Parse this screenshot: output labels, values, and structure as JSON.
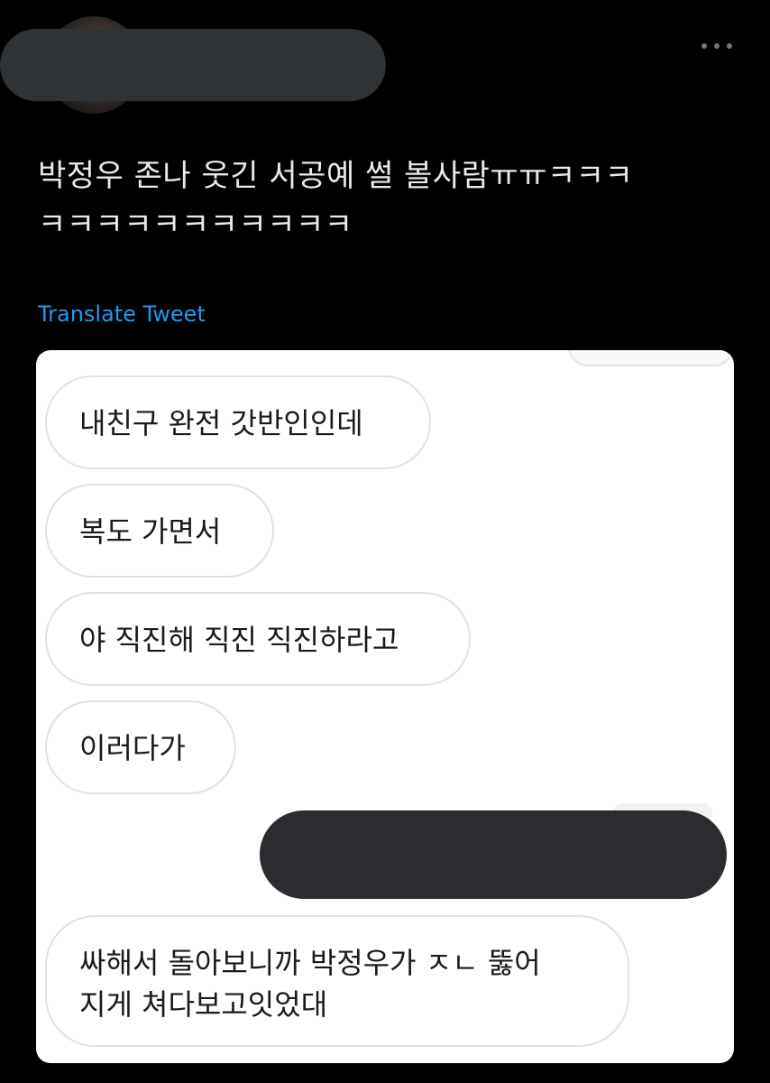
{
  "tweet": {
    "text_line1": "박정우 존나 웃긴 서공예 썰 볼사람ㅠㅠㅋㅋㅋ",
    "text_line2": "ㅋㅋㅋㅋㅋㅋㅋㅋㅋㅋㅋ",
    "translate_label": "Translate Tweet"
  },
  "chat": {
    "messages": [
      {
        "text": "내친구 완전 갓반인인데"
      },
      {
        "text": "복도 가면서"
      },
      {
        "text": "야 직진해 직진 직진하라고"
      },
      {
        "text": "이러다가"
      },
      {
        "text": "싸해서 돌아보니까 박정우가 ㅈㄴ 뚫어\n지게 쳐다보고잇었대"
      }
    ]
  },
  "colors": {
    "background": "#000000",
    "tweet_text": "#e7e9ea",
    "link": "#1d9bf0",
    "redaction": "#2f3336"
  }
}
